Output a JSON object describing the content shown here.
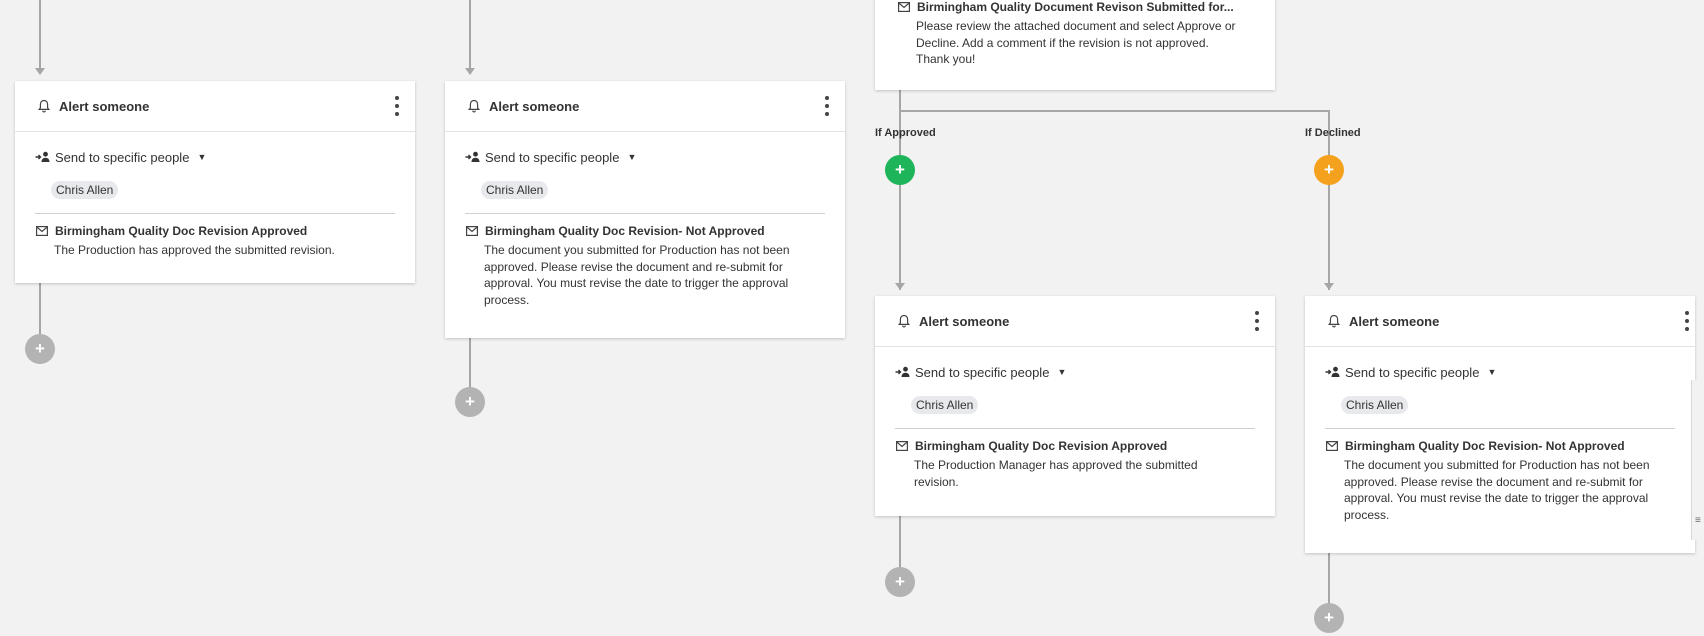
{
  "cards": [
    {
      "title": "Alert someone",
      "send_label": "Send to specific people",
      "recipient": "Chris Allen",
      "subject": "Birmingham Quality Doc Revision Approved",
      "body": "The Production has approved the submitted revision."
    },
    {
      "title": "Alert someone",
      "send_label": "Send to specific people",
      "recipient": "Chris Allen",
      "subject": "Birmingham Quality Doc Revision- Not Approved",
      "body": "The document you submitted for Production has not been approved. Please revise the document and re-submit for approval. You must revise the date to trigger the approval process."
    },
    {
      "title": "Alert someone",
      "send_label": "Send to specific people",
      "recipient": "Chris Allen",
      "subject": "Birmingham Quality Doc Revision Approved",
      "body": "The Production Manager has approved the submitted revision."
    },
    {
      "title": "Alert someone",
      "send_label": "Send to specific people",
      "recipient": "Chris Allen",
      "subject": "Birmingham Quality Doc Revision- Not Approved",
      "body": "The document you submitted for Production has not been approved. Please revise the document and re-submit for approval. You must revise the date to trigger the approval process."
    }
  ],
  "approval_card": {
    "subject": "Birmingham Quality Document Revison Submitted for...",
    "body": "Please review the attached document and select Approve or Decline. Add a comment if the revision is not approved. Thank you!"
  },
  "branches": {
    "approved_label": "If Approved",
    "declined_label": "If Declined"
  },
  "add_symbol": "+",
  "colors": {
    "approved": "#1db45a",
    "declined": "#f4a21e",
    "connector": "#a6a6a6"
  }
}
